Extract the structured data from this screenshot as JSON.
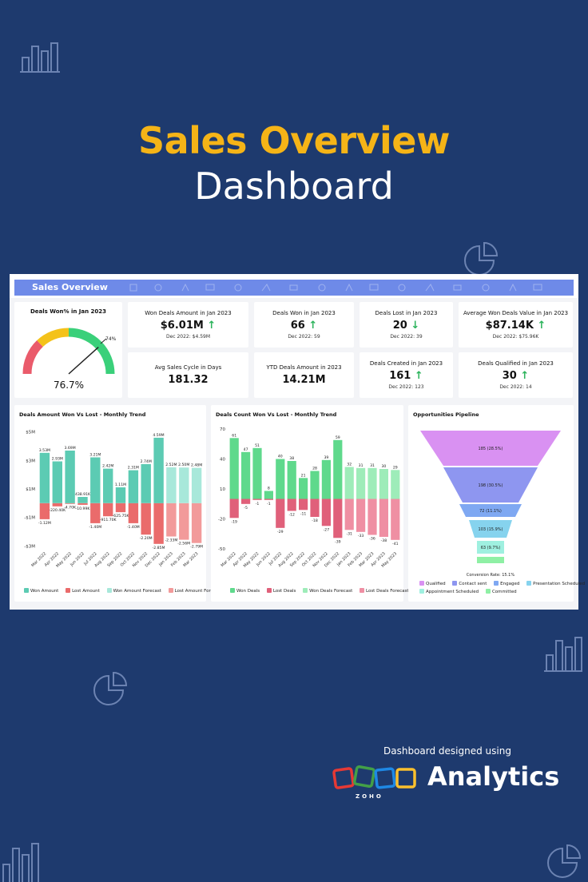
{
  "hero": {
    "title": "Sales Overview",
    "subtitle": "Dashboard"
  },
  "panel": {
    "title": "Sales Overview",
    "header_color": "#6e8ae8"
  },
  "gauge": {
    "title": "Deals Won% in Jan 2023",
    "value_label": "76.7%",
    "target_label": "74%",
    "value": 76.7
  },
  "kpis": {
    "won_amount": {
      "title": "Won Deals Amount in Jan 2023",
      "value": "$6.01M",
      "arrow": "↑",
      "sub": "Dec 2022: $4.59M"
    },
    "deals_won": {
      "title": "Deals Won in Jan 2023",
      "value": "66",
      "arrow": "↑",
      "sub": "Dec 2022: 59"
    },
    "deals_lost": {
      "title": "Deals Lost in Jan 2023",
      "value": "20",
      "arrow": "↓",
      "sub": "Dec 2022: 39"
    },
    "avg_won_value": {
      "title": "Average Won Deals Value in Jan 2023",
      "value": "$87.14K",
      "arrow": "↑",
      "sub": "Dec 2022: $75.96K"
    },
    "avg_cycle": {
      "title": "Avg Sales Cycle in Days",
      "value": "181.32"
    },
    "ytd_amount": {
      "title": "YTD Deals Amount in 2023",
      "value": "14.21M"
    },
    "deals_created": {
      "title": "Deals Created in Jan 2023",
      "value": "161",
      "arrow": "↑",
      "sub": "Dec 2022: 123"
    },
    "deals_qualified": {
      "title": "Deals Qualified in Jan 2023",
      "value": "30",
      "arrow": "↑",
      "sub": "Dec 2022: 14"
    }
  },
  "legend_amount": {
    "won": "Won Amount",
    "lost": "Lost Amount",
    "won_forecast": "Won Amount Forecast",
    "lost_forecast": "Lost Amount Forecast"
  },
  "legend_count": {
    "won": "Won Deals",
    "lost": "Lost Deals",
    "won_forecast": "Won Deals Forecast",
    "lost_forecast": "Lost Deals Forecast"
  },
  "legend_pipeline": {
    "qualified": "Qualified",
    "contact": "Contact sent",
    "engaged": "Engaged",
    "presentation": "Presentation Scheduled",
    "appointment": "Appointment Scheduled",
    "committed": "Committed"
  },
  "colors": {
    "won": "#5ccbb3",
    "lost": "#ea6b6b",
    "won_forecast": "#a8e8da",
    "lost_forecast": "#f29a9a",
    "won_deals": "#5fd98c",
    "won_deals_forecast": "#9eecb9",
    "lost_deals": "#e0607a",
    "lost_deals_forecast": "#ef8fa3"
  },
  "chart_data": [
    {
      "type": "bar",
      "title": "Deals Amount Won Vs Lost - Monthly Trend",
      "categories": [
        "Mar 2022",
        "Apr 2022",
        "May 2022",
        "Jun 2022",
        "Jul 2022",
        "Aug 2022",
        "Sep 2022",
        "Oct 2022",
        "Nov 2022",
        "Dec 2022",
        "Jan 2023",
        "Feb 2023",
        "Mar 2023"
      ],
      "yticks": [
        "$5M",
        "$3M",
        "$1M",
        "-$1M",
        "-$3M"
      ],
      "ylim": [
        -3.2,
        5.2
      ],
      "series": [
        {
          "name": "Won Amount",
          "values": [
            3.53,
            2.93,
            3.69,
            0.43891,
            3.21,
            2.42,
            1.11,
            2.31,
            2.74,
            4.59,
            null,
            null,
            null
          ],
          "labels": [
            "3.53M",
            "2.93M",
            "3.69M",
            "438.91K",
            "3.21M",
            "2.42M",
            "1.11M",
            "2.31M",
            "2.74M",
            "4.59M",
            "",
            "",
            ""
          ]
        },
        {
          "name": "Lost Amount",
          "values": [
            -1.12,
            -0.2204,
            -0.047,
            -0.1099,
            -1.4,
            -0.9117,
            -0.62575,
            -1.4,
            -2.2,
            -2.85,
            null,
            null,
            null
          ],
          "labels": [
            "-1.12M",
            "-220.40K",
            "-4.70K",
            "-10.99K",
            "-1.40M",
            "-911.70K",
            "-625.75K",
            "-1.40M",
            "-2.20M",
            "-2.85M",
            "",
            "",
            ""
          ]
        },
        {
          "name": "Won Amount Forecast",
          "values": [
            null,
            null,
            null,
            null,
            null,
            null,
            null,
            null,
            null,
            null,
            2.52,
            2.5,
            2.48
          ],
          "labels": [
            "",
            "",
            "",
            "",
            "",
            "",
            "",
            "",
            "",
            "",
            "2.52M",
            "2.50M",
            "2.48M"
          ]
        },
        {
          "name": "Lost Amount Forecast",
          "values": [
            null,
            null,
            null,
            null,
            null,
            null,
            null,
            null,
            null,
            null,
            -2.33,
            -2.56,
            -2.79
          ],
          "labels": [
            "",
            "",
            "",
            "",
            "",
            "",
            "",
            "",
            "",
            "",
            "-2.33M",
            "-2.56M",
            "-2.79M"
          ]
        }
      ]
    },
    {
      "type": "bar",
      "title": "Deals Count Won Vs Lost - Monthly Trend",
      "categories": [
        "Mar 2022",
        "Apr 2022",
        "May 2022",
        "Jun 2022",
        "Jul 2022",
        "Aug 2022",
        "Sep 2022",
        "Oct 2022",
        "Nov 2022",
        "Dec 2022",
        "Jan 2023",
        "Feb 2023",
        "Mar 2023",
        "Apr 2023",
        "May 2023"
      ],
      "yticks": [
        "70",
        "40",
        "10",
        "-20",
        "-50"
      ],
      "ylim": [
        -50,
        70
      ],
      "series": [
        {
          "name": "Won Deals",
          "values": [
            61,
            47,
            51,
            8,
            40,
            38,
            21,
            28,
            39,
            59,
            null,
            null,
            null,
            null,
            null
          ]
        },
        {
          "name": "Lost Deals",
          "values": [
            -19,
            -5,
            -1,
            -1,
            -29,
            -12,
            -11,
            -18,
            -27,
            -39,
            null,
            null,
            null,
            null,
            null
          ]
        },
        {
          "name": "Won Deals Forecast",
          "values": [
            null,
            null,
            null,
            null,
            null,
            null,
            null,
            null,
            null,
            null,
            32,
            31,
            31,
            30,
            29
          ]
        },
        {
          "name": "Lost Deals Forecast",
          "values": [
            null,
            null,
            null,
            null,
            null,
            null,
            null,
            null,
            null,
            null,
            -31,
            -33,
            -36,
            -38,
            -41
          ]
        }
      ]
    },
    {
      "type": "funnel",
      "title": "Opportunities Pipeline",
      "stages": [
        {
          "name": "Qualified",
          "value": 185,
          "label": "185 (28.5%)",
          "color": "#d991f2"
        },
        {
          "name": "Contact sent",
          "value": 198,
          "label": "198 (30.5%)",
          "color": "#8e96f0"
        },
        {
          "name": "Engaged",
          "value": 72,
          "label": "72 (11.1%)",
          "color": "#7fa8f2"
        },
        {
          "name": "Presentation Scheduled",
          "value": 103,
          "label": "103 (15.9%)",
          "color": "#86d3ee"
        },
        {
          "name": "Appointment Scheduled",
          "value": 63,
          "label": "63 (9.7%)",
          "color": "#9ff0e0"
        },
        {
          "name": "Committed",
          "value": 0,
          "label": "",
          "color": "#8ff0a5"
        }
      ],
      "note": "Conversion Rate: 15.1%"
    }
  ],
  "footer": {
    "note": "Dashboard designed using",
    "brand": "Analytics",
    "zoho": "ZOHO"
  }
}
